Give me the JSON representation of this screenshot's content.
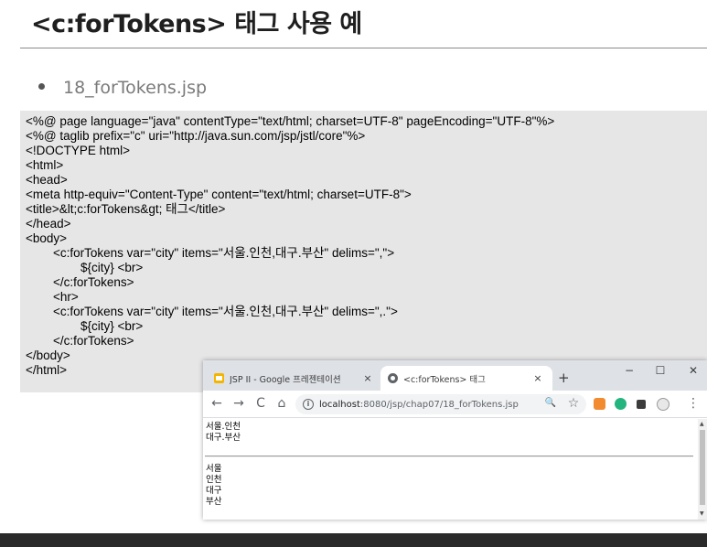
{
  "slide": {
    "title": "<c:forTokens> 태그 사용 예",
    "bullet": "18_forTokens.jsp"
  },
  "code_lines": [
    "<%@ page language=\"java\" contentType=\"text/html; charset=UTF-8\" pageEncoding=\"UTF-8\"%>",
    "<%@ taglib prefix=\"c\" uri=\"http://java.sun.com/jsp/jstl/core\"%>",
    "<!DOCTYPE html>",
    "<html>",
    "<head>",
    "<meta http-equiv=\"Content-Type\" content=\"text/html; charset=UTF-8\">",
    "<title>&lt;c:forTokens&gt; 태그</title>",
    "</head>",
    "<body>",
    "        <c:forTokens var=\"city\" items=\"서울.인천,대구.부산\" delims=\",\">",
    "                ${city} <br>",
    "        </c:forTokens>",
    "        <hr>",
    "        <c:forTokens var=\"city\" items=\"서울.인천,대구.부산\" delims=\",.\">",
    "                ${city} <br>",
    "        </c:forTokens>",
    "</body>",
    "</html>"
  ],
  "browser": {
    "tabs": [
      {
        "label": "JSP II - Google 프레젠테이션",
        "close": "×"
      },
      {
        "label": "<c:forTokens> 태그",
        "close": "×"
      }
    ],
    "new_tab": "+",
    "window_controls": {
      "minimize": "−",
      "maximize": "☐",
      "close": "✕"
    },
    "nav": {
      "back": "←",
      "forward": "→",
      "reload": "C",
      "home": "⌂"
    },
    "address": {
      "host": "localhost",
      "path": ":8080/jsp/chap07/18_forTokens.jsp"
    },
    "toolbar_icons": {
      "zoom": "🔍",
      "star": "☆",
      "menu": "⋮"
    },
    "page_output_first": [
      "서울.인천",
      "대구.부산"
    ],
    "page_output_second": [
      "서울",
      "인천",
      "대구",
      "부산"
    ]
  },
  "colors": {
    "code_bg": "#e6e6e6",
    "tabstrip_bg": "#dee1e6",
    "slides_icon": "#f4b400",
    "ext1": "#f28b30",
    "ext2": "#24b47e"
  }
}
